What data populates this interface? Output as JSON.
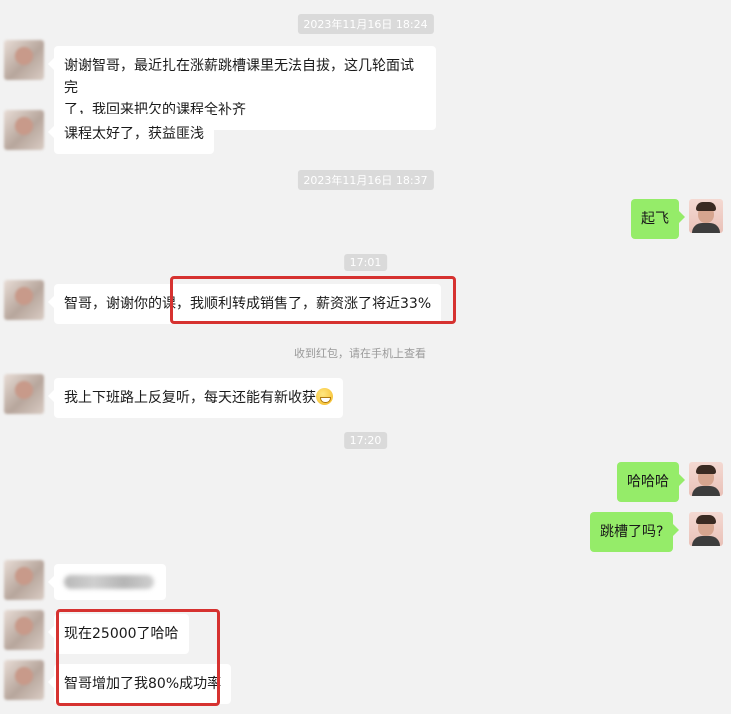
{
  "timestamps": [
    "2023年11月16日 18:24",
    "2023年11月16日 18:37",
    "17:01",
    "17:20"
  ],
  "messages": {
    "m1": "谢谢智哥，最近扎在涨薪跳槽课里无法自拔，这几轮面试完了，我回来把欠的课程全补齐",
    "m1_line1": "谢谢智哥，最近扎在涨薪跳槽课里无法自拔，这几轮面试完",
    "m1_line2": "了，我回来把欠的课程全补齐",
    "m2": "课程太好了，获益匪浅",
    "m3": "起飞",
    "m4": "智哥，谢谢你的课，我顺利转成销售了，薪资涨了将近33%",
    "m5": "我上下班路上反复听，每天还能有新收获",
    "m6": "哈哈哈",
    "m7": "跳槽了吗?",
    "m8": "现在25000了哈哈",
    "m9": "智哥增加了我80%成功率"
  },
  "system_notice": "收到红包，请在手机上查看",
  "icons": {
    "emoji": "grin-emoji-icon",
    "avatar_other": "blurred-avatar-icon",
    "avatar_self": "user-avatar-icon"
  },
  "colors": {
    "background": "#f2f2f2",
    "bubble_in": "#ffffff",
    "bubble_out": "#95ec69",
    "highlight": "#d63230"
  }
}
